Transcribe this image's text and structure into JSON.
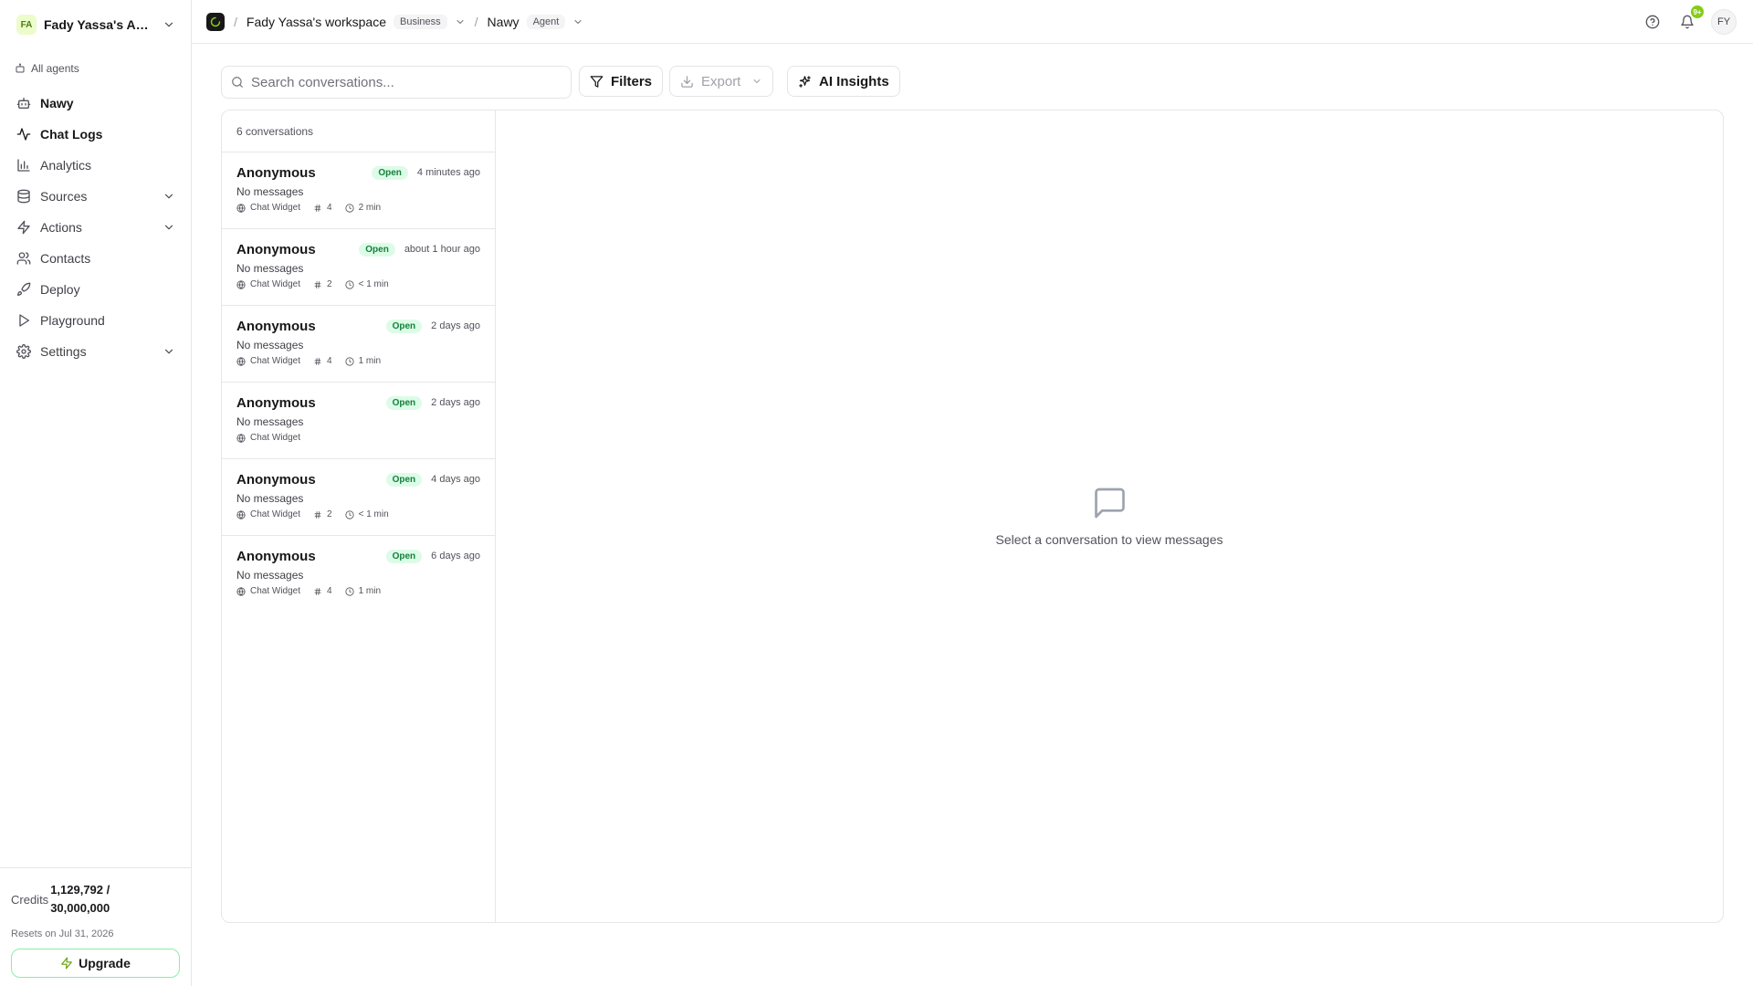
{
  "account": {
    "initials": "FA",
    "name": "Fady Yassa's Acc..."
  },
  "sidebar": {
    "all_agents": "All agents",
    "items": [
      {
        "label": "Nawy",
        "icon": "bot-icon",
        "active": false,
        "expandable": false
      },
      {
        "label": "Chat Logs",
        "icon": "activity-icon",
        "active": true,
        "expandable": false
      },
      {
        "label": "Analytics",
        "icon": "bar-chart-icon",
        "active": false,
        "expandable": false
      },
      {
        "label": "Sources",
        "icon": "database-icon",
        "active": false,
        "expandable": true
      },
      {
        "label": "Actions",
        "icon": "zap-icon",
        "active": false,
        "expandable": true
      },
      {
        "label": "Contacts",
        "icon": "users-icon",
        "active": false,
        "expandable": false
      },
      {
        "label": "Deploy",
        "icon": "rocket-icon",
        "active": false,
        "expandable": false
      },
      {
        "label": "Playground",
        "icon": "play-icon",
        "active": false,
        "expandable": false
      },
      {
        "label": "Settings",
        "icon": "gear-icon",
        "active": false,
        "expandable": true
      }
    ],
    "credits_label": "Credits",
    "credits_value": "1,129,792 / 30,000,000",
    "resets": "Resets on Jul 31, 2026",
    "upgrade_label": "Upgrade"
  },
  "topbar": {
    "workspace": "Fady Yassa's workspace",
    "workspace_plan": "Business",
    "agent": "Nawy",
    "agent_tag": "Agent",
    "notif_count": "9+",
    "user_initials": "FY"
  },
  "toolbar": {
    "search_placeholder": "Search conversations...",
    "filters_label": "Filters",
    "export_label": "Export",
    "insights_label": "AI Insights"
  },
  "conversations": {
    "count_label": "6 conversations",
    "items": [
      {
        "name": "Anonymous",
        "status": "Open",
        "time": "4 minutes ago",
        "preview": "No messages",
        "source": "Chat Widget",
        "messages": "4",
        "duration": "2 min"
      },
      {
        "name": "Anonymous",
        "status": "Open",
        "time": "about 1 hour ago",
        "preview": "No messages",
        "source": "Chat Widget",
        "messages": "2",
        "duration": "< 1 min"
      },
      {
        "name": "Anonymous",
        "status": "Open",
        "time": "2 days ago",
        "preview": "No messages",
        "source": "Chat Widget",
        "messages": "4",
        "duration": "1 min"
      },
      {
        "name": "Anonymous",
        "status": "Open",
        "time": "2 days ago",
        "preview": "No messages",
        "source": "Chat Widget",
        "messages": "",
        "duration": ""
      },
      {
        "name": "Anonymous",
        "status": "Open",
        "time": "4 days ago",
        "preview": "No messages",
        "source": "Chat Widget",
        "messages": "2",
        "duration": "< 1 min"
      },
      {
        "name": "Anonymous",
        "status": "Open",
        "time": "6 days ago",
        "preview": "No messages",
        "source": "Chat Widget",
        "messages": "4",
        "duration": "1 min"
      }
    ]
  },
  "empty_state": {
    "text": "Select a conversation to view messages",
    "icon": "message-square-icon"
  },
  "colors": {
    "accent": "#84cc16",
    "open_badge_bg": "#dcfce7",
    "open_badge_text": "#15803d"
  }
}
